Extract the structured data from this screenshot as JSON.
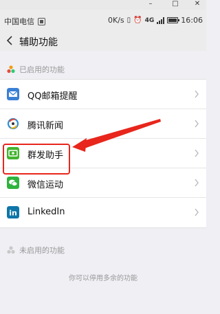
{
  "status_bar": {
    "carrier": "中国电信",
    "speed": "0K/s",
    "network": "4G",
    "time": "16:06"
  },
  "header": {
    "title": "辅助功能"
  },
  "enabled_section": {
    "label": "已启用的功能"
  },
  "features": [
    {
      "label": "QQ邮箱提醒",
      "icon": "mail-icon",
      "color": "#3a7fd5"
    },
    {
      "label": "腾讯新闻",
      "icon": "news-icon",
      "color": "#e24a3b"
    },
    {
      "label": "群发助手",
      "icon": "broadcast-icon",
      "color": "#43b42f"
    },
    {
      "label": "微信运动",
      "icon": "sport-icon",
      "color": "#2fb33d"
    },
    {
      "label": "LinkedIn",
      "icon": "linkedin-icon",
      "color": "#0e76a8"
    }
  ],
  "disabled_section": {
    "label": "未启用的功能"
  },
  "note": "你可以停用多余的功能",
  "colors": {
    "annotation_red": "#e8261c",
    "background": "#efeff4"
  }
}
